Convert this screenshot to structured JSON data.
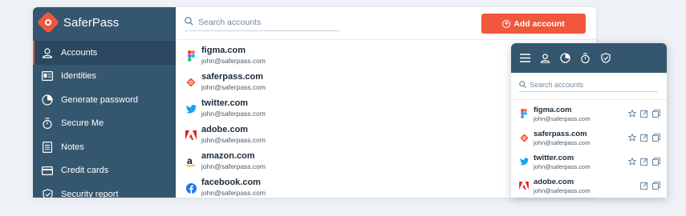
{
  "app": {
    "name": "SaferPass",
    "colors": {
      "sidebar": "#35566f",
      "accent": "#f0573c"
    }
  },
  "sidebar": {
    "items": [
      {
        "label": "Accounts",
        "icon": "user-icon",
        "active": true
      },
      {
        "label": "Identities",
        "icon": "id-card-icon"
      },
      {
        "label": "Generate password",
        "icon": "password-generator-icon"
      },
      {
        "label": "Secure Me",
        "icon": "stopwatch-icon"
      },
      {
        "label": "Notes",
        "icon": "note-icon"
      },
      {
        "label": "Credit cards",
        "icon": "credit-card-icon"
      },
      {
        "label": "Security report",
        "icon": "shield-icon"
      }
    ]
  },
  "search": {
    "placeholder": "Search accounts"
  },
  "toolbar": {
    "add_label": "Add account"
  },
  "accounts": [
    {
      "domain": "figma.com",
      "email": "john@saferpass.com",
      "icon": "figma-icon"
    },
    {
      "domain": "saferpass.com",
      "email": "john@saferpass.com",
      "icon": "saferpass-icon"
    },
    {
      "domain": "twitter.com",
      "email": "john@saferpass.com",
      "icon": "twitter-icon"
    },
    {
      "domain": "adobe.com",
      "email": "john@saferpass.com",
      "icon": "adobe-icon"
    },
    {
      "domain": "amazon.com",
      "email": "john@saferpass.com",
      "icon": "amazon-icon"
    },
    {
      "domain": "facebook.com",
      "email": "john@saferpass.com",
      "icon": "facebook-icon"
    }
  ],
  "extension": {
    "toolbar_icons": [
      "menu-icon",
      "user-icon",
      "password-generator-icon",
      "stopwatch-icon",
      "shield-icon"
    ],
    "search": {
      "placeholder": "Search accounts"
    },
    "accounts": [
      {
        "domain": "figma.com",
        "email": "john@saferpass.com",
        "icon": "figma-icon"
      },
      {
        "domain": "saferpass.com",
        "email": "john@saferpass.com",
        "icon": "saferpass-icon"
      },
      {
        "domain": "twitter.com",
        "email": "john@saferpass.com",
        "icon": "twitter-icon"
      },
      {
        "domain": "adobe.com",
        "email": "john@saferpass.com",
        "icon": "adobe-icon"
      }
    ],
    "row_actions": [
      "star-icon",
      "edit-icon",
      "copy-icon"
    ]
  }
}
